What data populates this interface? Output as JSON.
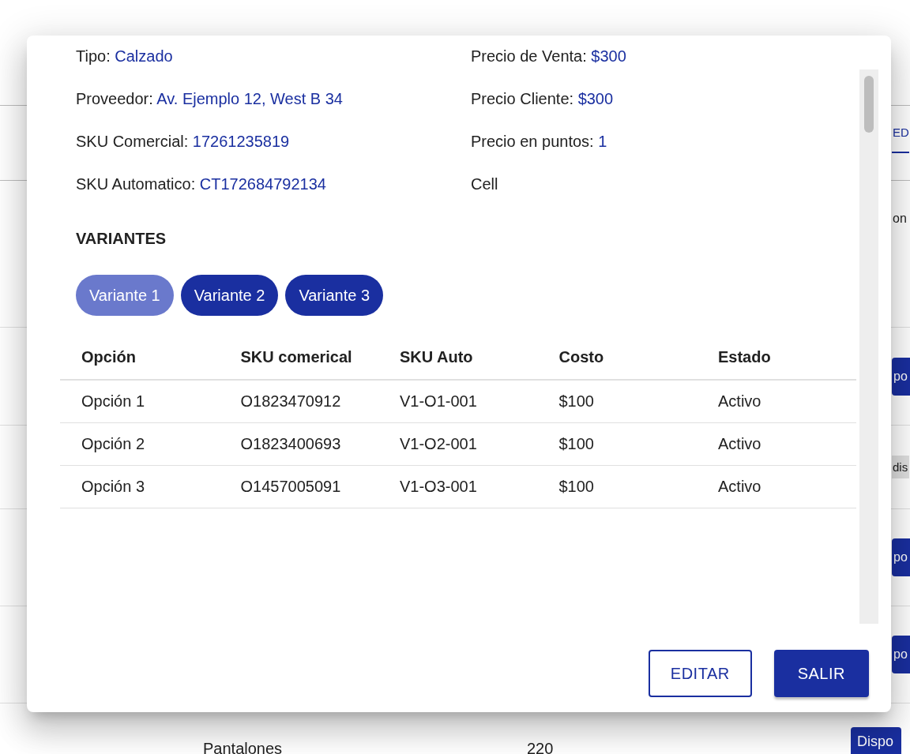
{
  "background": {
    "tab": {
      "label": "ED",
      "selected": true
    },
    "rows": [
      {
        "kind": "text",
        "text": "on"
      },
      {
        "kind": "button",
        "text": "po"
      },
      {
        "kind": "chip",
        "text": "dis"
      },
      {
        "kind": "button",
        "text": "po"
      },
      {
        "kind": "button",
        "text": "po"
      }
    ],
    "last_row": {
      "name": "Pantalones",
      "quantity": "220",
      "status": "Dispo"
    }
  },
  "dialog": {
    "fields": [
      {
        "label": "Tipo:",
        "value": "Calzado"
      },
      {
        "label": "Precio de Venta:",
        "value": "$300"
      },
      {
        "label": "Proveedor:",
        "value": "Av. Ejemplo 12, West B 34"
      },
      {
        "label": "Precio Cliente:",
        "value": "$300"
      },
      {
        "label": "SKU Comercial:",
        "value": "17261235819"
      },
      {
        "label": "Precio en puntos:",
        "value": "1"
      },
      {
        "label": "SKU Automatico:",
        "value": "CT172684792134"
      },
      {
        "label": "Cell"
      }
    ],
    "variants_title": "VARIANTES",
    "variants": [
      {
        "label": "Variante 1",
        "selected": true
      },
      {
        "label": "Variante 2",
        "selected": false
      },
      {
        "label": "Variante 3",
        "selected": false
      }
    ],
    "table": {
      "columns": [
        "Opción",
        "SKU comerical",
        "SKU Auto",
        "Costo",
        "Estado"
      ],
      "rows": [
        [
          "Opción 1",
          "O1823470912",
          "V1-O1-001",
          "$100",
          "Activo"
        ],
        [
          "Opción 2",
          "O1823400693",
          "V1-O2-001",
          "$100",
          "Activo"
        ],
        [
          "Opción 3",
          "O1457005091",
          "V1-O3-001",
          "$100",
          "Activo"
        ]
      ]
    },
    "buttons": [
      {
        "label": "EDITAR",
        "kind": "outlined"
      },
      {
        "label": "SALIR",
        "kind": "filled"
      }
    ]
  }
}
